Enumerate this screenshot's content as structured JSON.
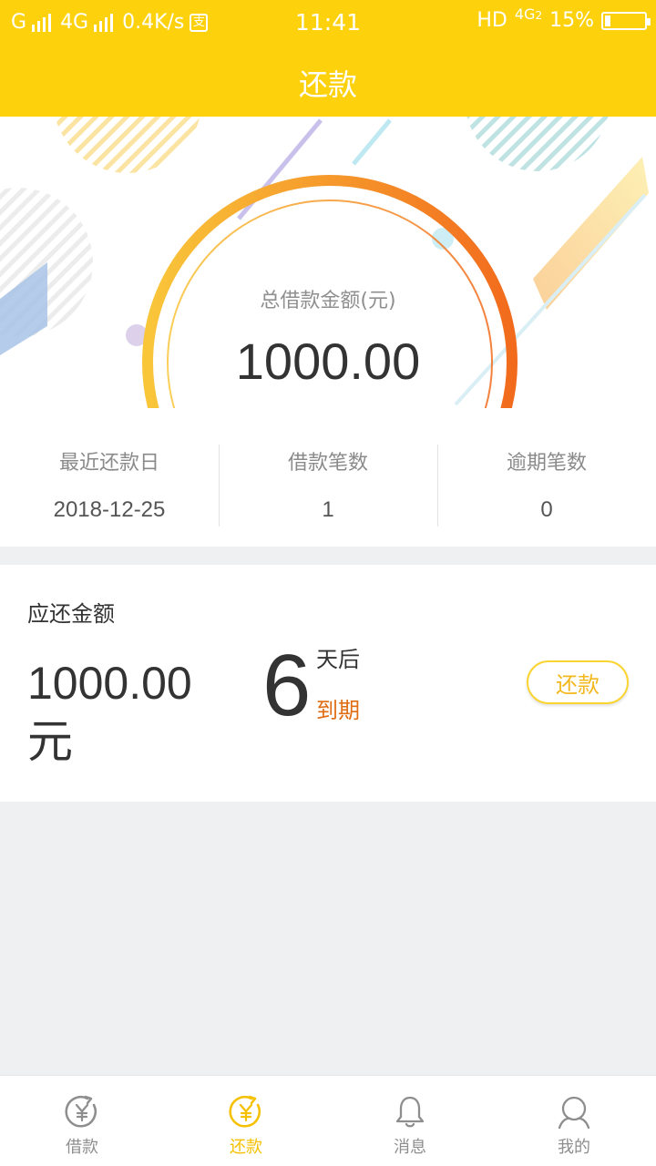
{
  "status_bar": {
    "carrier1": "G",
    "carrier2": "4G",
    "speed": "0.4K/s",
    "time": "11:41",
    "hd": "HD",
    "network": "4G",
    "sim": "2",
    "battery": "15%",
    "battery_level": 0.15
  },
  "header": {
    "title": "还款"
  },
  "hero": {
    "label": "总借款金额(元)",
    "amount": "1000.00"
  },
  "stats": [
    {
      "label": "最近还款日",
      "value": "2018-12-25"
    },
    {
      "label": "借款笔数",
      "value": "1"
    },
    {
      "label": "逾期笔数",
      "value": "0"
    }
  ],
  "repay": {
    "heading": "应还金额",
    "amount": "1000.00",
    "unit": "元",
    "days": "6",
    "days_after": "天后",
    "due": "到期",
    "button": "还款"
  },
  "tabs": [
    {
      "label": "借款",
      "icon": "yuan-circle-icon",
      "active": false
    },
    {
      "label": "还款",
      "icon": "yuan-circle-icon",
      "active": true
    },
    {
      "label": "消息",
      "icon": "bell-icon",
      "active": false
    },
    {
      "label": "我的",
      "icon": "user-icon",
      "active": false
    }
  ],
  "colors": {
    "brand": "#fdd20d",
    "accent": "#f5c000",
    "due": "#e06d12",
    "ring_start": "#f9c63a",
    "ring_end": "#f26b1d"
  }
}
